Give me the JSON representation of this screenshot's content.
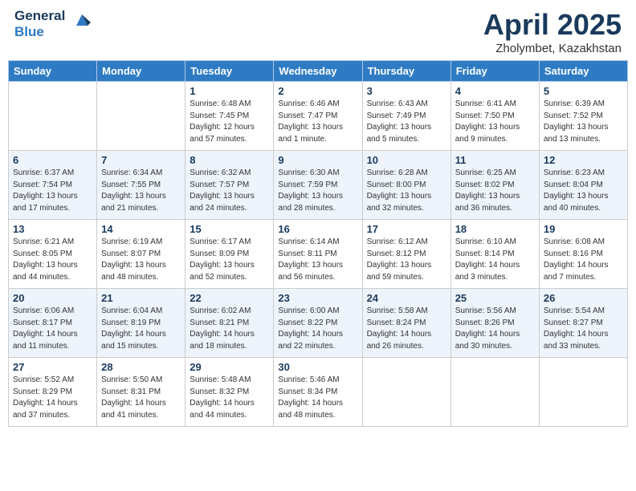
{
  "header": {
    "logo": {
      "general": "General",
      "blue": "Blue"
    },
    "title": "April 2025",
    "location": "Zholymbet, Kazakhstan"
  },
  "days_of_week": [
    "Sunday",
    "Monday",
    "Tuesday",
    "Wednesday",
    "Thursday",
    "Friday",
    "Saturday"
  ],
  "weeks": [
    [
      {
        "day": "",
        "info": ""
      },
      {
        "day": "",
        "info": ""
      },
      {
        "day": "1",
        "info": "Sunrise: 6:48 AM\nSunset: 7:45 PM\nDaylight: 12 hours and 57 minutes."
      },
      {
        "day": "2",
        "info": "Sunrise: 6:46 AM\nSunset: 7:47 PM\nDaylight: 13 hours and 1 minute."
      },
      {
        "day": "3",
        "info": "Sunrise: 6:43 AM\nSunset: 7:49 PM\nDaylight: 13 hours and 5 minutes."
      },
      {
        "day": "4",
        "info": "Sunrise: 6:41 AM\nSunset: 7:50 PM\nDaylight: 13 hours and 9 minutes."
      },
      {
        "day": "5",
        "info": "Sunrise: 6:39 AM\nSunset: 7:52 PM\nDaylight: 13 hours and 13 minutes."
      }
    ],
    [
      {
        "day": "6",
        "info": "Sunrise: 6:37 AM\nSunset: 7:54 PM\nDaylight: 13 hours and 17 minutes."
      },
      {
        "day": "7",
        "info": "Sunrise: 6:34 AM\nSunset: 7:55 PM\nDaylight: 13 hours and 21 minutes."
      },
      {
        "day": "8",
        "info": "Sunrise: 6:32 AM\nSunset: 7:57 PM\nDaylight: 13 hours and 24 minutes."
      },
      {
        "day": "9",
        "info": "Sunrise: 6:30 AM\nSunset: 7:59 PM\nDaylight: 13 hours and 28 minutes."
      },
      {
        "day": "10",
        "info": "Sunrise: 6:28 AM\nSunset: 8:00 PM\nDaylight: 13 hours and 32 minutes."
      },
      {
        "day": "11",
        "info": "Sunrise: 6:25 AM\nSunset: 8:02 PM\nDaylight: 13 hours and 36 minutes."
      },
      {
        "day": "12",
        "info": "Sunrise: 6:23 AM\nSunset: 8:04 PM\nDaylight: 13 hours and 40 minutes."
      }
    ],
    [
      {
        "day": "13",
        "info": "Sunrise: 6:21 AM\nSunset: 8:05 PM\nDaylight: 13 hours and 44 minutes."
      },
      {
        "day": "14",
        "info": "Sunrise: 6:19 AM\nSunset: 8:07 PM\nDaylight: 13 hours and 48 minutes."
      },
      {
        "day": "15",
        "info": "Sunrise: 6:17 AM\nSunset: 8:09 PM\nDaylight: 13 hours and 52 minutes."
      },
      {
        "day": "16",
        "info": "Sunrise: 6:14 AM\nSunset: 8:11 PM\nDaylight: 13 hours and 56 minutes."
      },
      {
        "day": "17",
        "info": "Sunrise: 6:12 AM\nSunset: 8:12 PM\nDaylight: 13 hours and 59 minutes."
      },
      {
        "day": "18",
        "info": "Sunrise: 6:10 AM\nSunset: 8:14 PM\nDaylight: 14 hours and 3 minutes."
      },
      {
        "day": "19",
        "info": "Sunrise: 6:08 AM\nSunset: 8:16 PM\nDaylight: 14 hours and 7 minutes."
      }
    ],
    [
      {
        "day": "20",
        "info": "Sunrise: 6:06 AM\nSunset: 8:17 PM\nDaylight: 14 hours and 11 minutes."
      },
      {
        "day": "21",
        "info": "Sunrise: 6:04 AM\nSunset: 8:19 PM\nDaylight: 14 hours and 15 minutes."
      },
      {
        "day": "22",
        "info": "Sunrise: 6:02 AM\nSunset: 8:21 PM\nDaylight: 14 hours and 18 minutes."
      },
      {
        "day": "23",
        "info": "Sunrise: 6:00 AM\nSunset: 8:22 PM\nDaylight: 14 hours and 22 minutes."
      },
      {
        "day": "24",
        "info": "Sunrise: 5:58 AM\nSunset: 8:24 PM\nDaylight: 14 hours and 26 minutes."
      },
      {
        "day": "25",
        "info": "Sunrise: 5:56 AM\nSunset: 8:26 PM\nDaylight: 14 hours and 30 minutes."
      },
      {
        "day": "26",
        "info": "Sunrise: 5:54 AM\nSunset: 8:27 PM\nDaylight: 14 hours and 33 minutes."
      }
    ],
    [
      {
        "day": "27",
        "info": "Sunrise: 5:52 AM\nSunset: 8:29 PM\nDaylight: 14 hours and 37 minutes."
      },
      {
        "day": "28",
        "info": "Sunrise: 5:50 AM\nSunset: 8:31 PM\nDaylight: 14 hours and 41 minutes."
      },
      {
        "day": "29",
        "info": "Sunrise: 5:48 AM\nSunset: 8:32 PM\nDaylight: 14 hours and 44 minutes."
      },
      {
        "day": "30",
        "info": "Sunrise: 5:46 AM\nSunset: 8:34 PM\nDaylight: 14 hours and 48 minutes."
      },
      {
        "day": "",
        "info": ""
      },
      {
        "day": "",
        "info": ""
      },
      {
        "day": "",
        "info": ""
      }
    ]
  ]
}
